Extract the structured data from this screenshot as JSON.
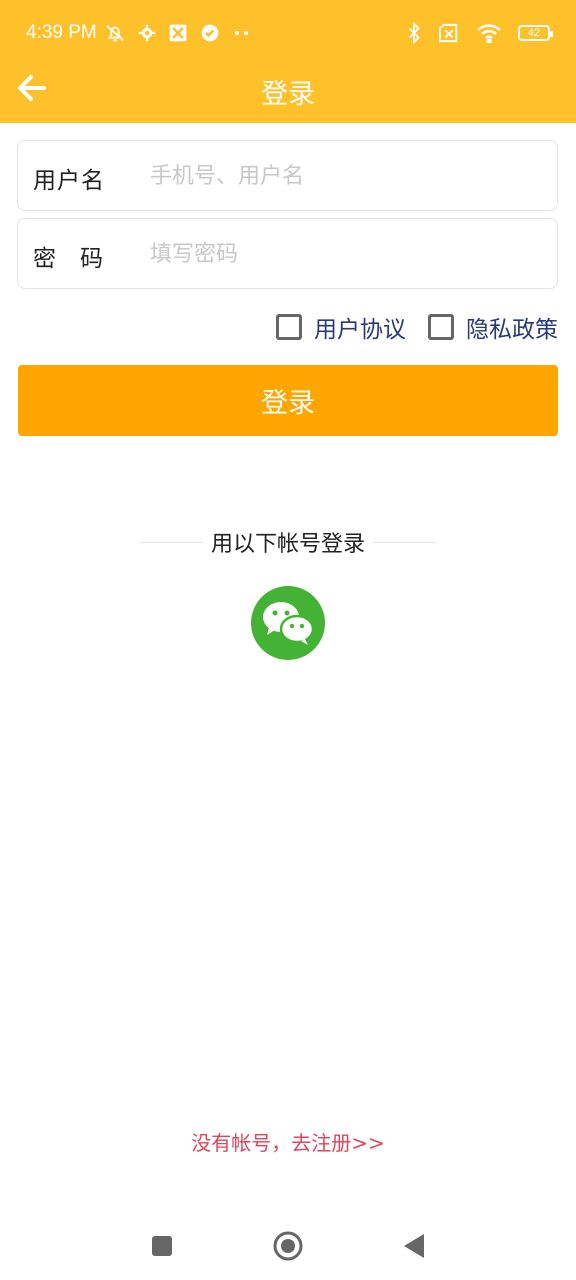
{
  "status_bar": {
    "time": "4:39 PM",
    "battery": "42",
    "icons_left": [
      "bell-muted-icon",
      "gear-icon",
      "app-icon",
      "check-circle-icon",
      "more-dots-icon"
    ],
    "icons_right": [
      "bluetooth-icon",
      "sim-x-icon",
      "wifi-icon",
      "battery-icon"
    ]
  },
  "header": {
    "title": "登录",
    "bg_color": "#FFC12A"
  },
  "form": {
    "username_label": "用户名",
    "username_placeholder": "手机号、用户名",
    "password_label": "密码",
    "password_placeholder": "填写密码"
  },
  "agreements": {
    "user_agreement": "用户协议",
    "privacy_policy": "隐私政策"
  },
  "login_button": {
    "label": "登录",
    "color": "#FFA500"
  },
  "social": {
    "divider_text": "用以下帐号登录",
    "wechat_color": "#44B335"
  },
  "register": {
    "link_text": "没有帐号，去注册>>",
    "color": "#E0445A"
  }
}
